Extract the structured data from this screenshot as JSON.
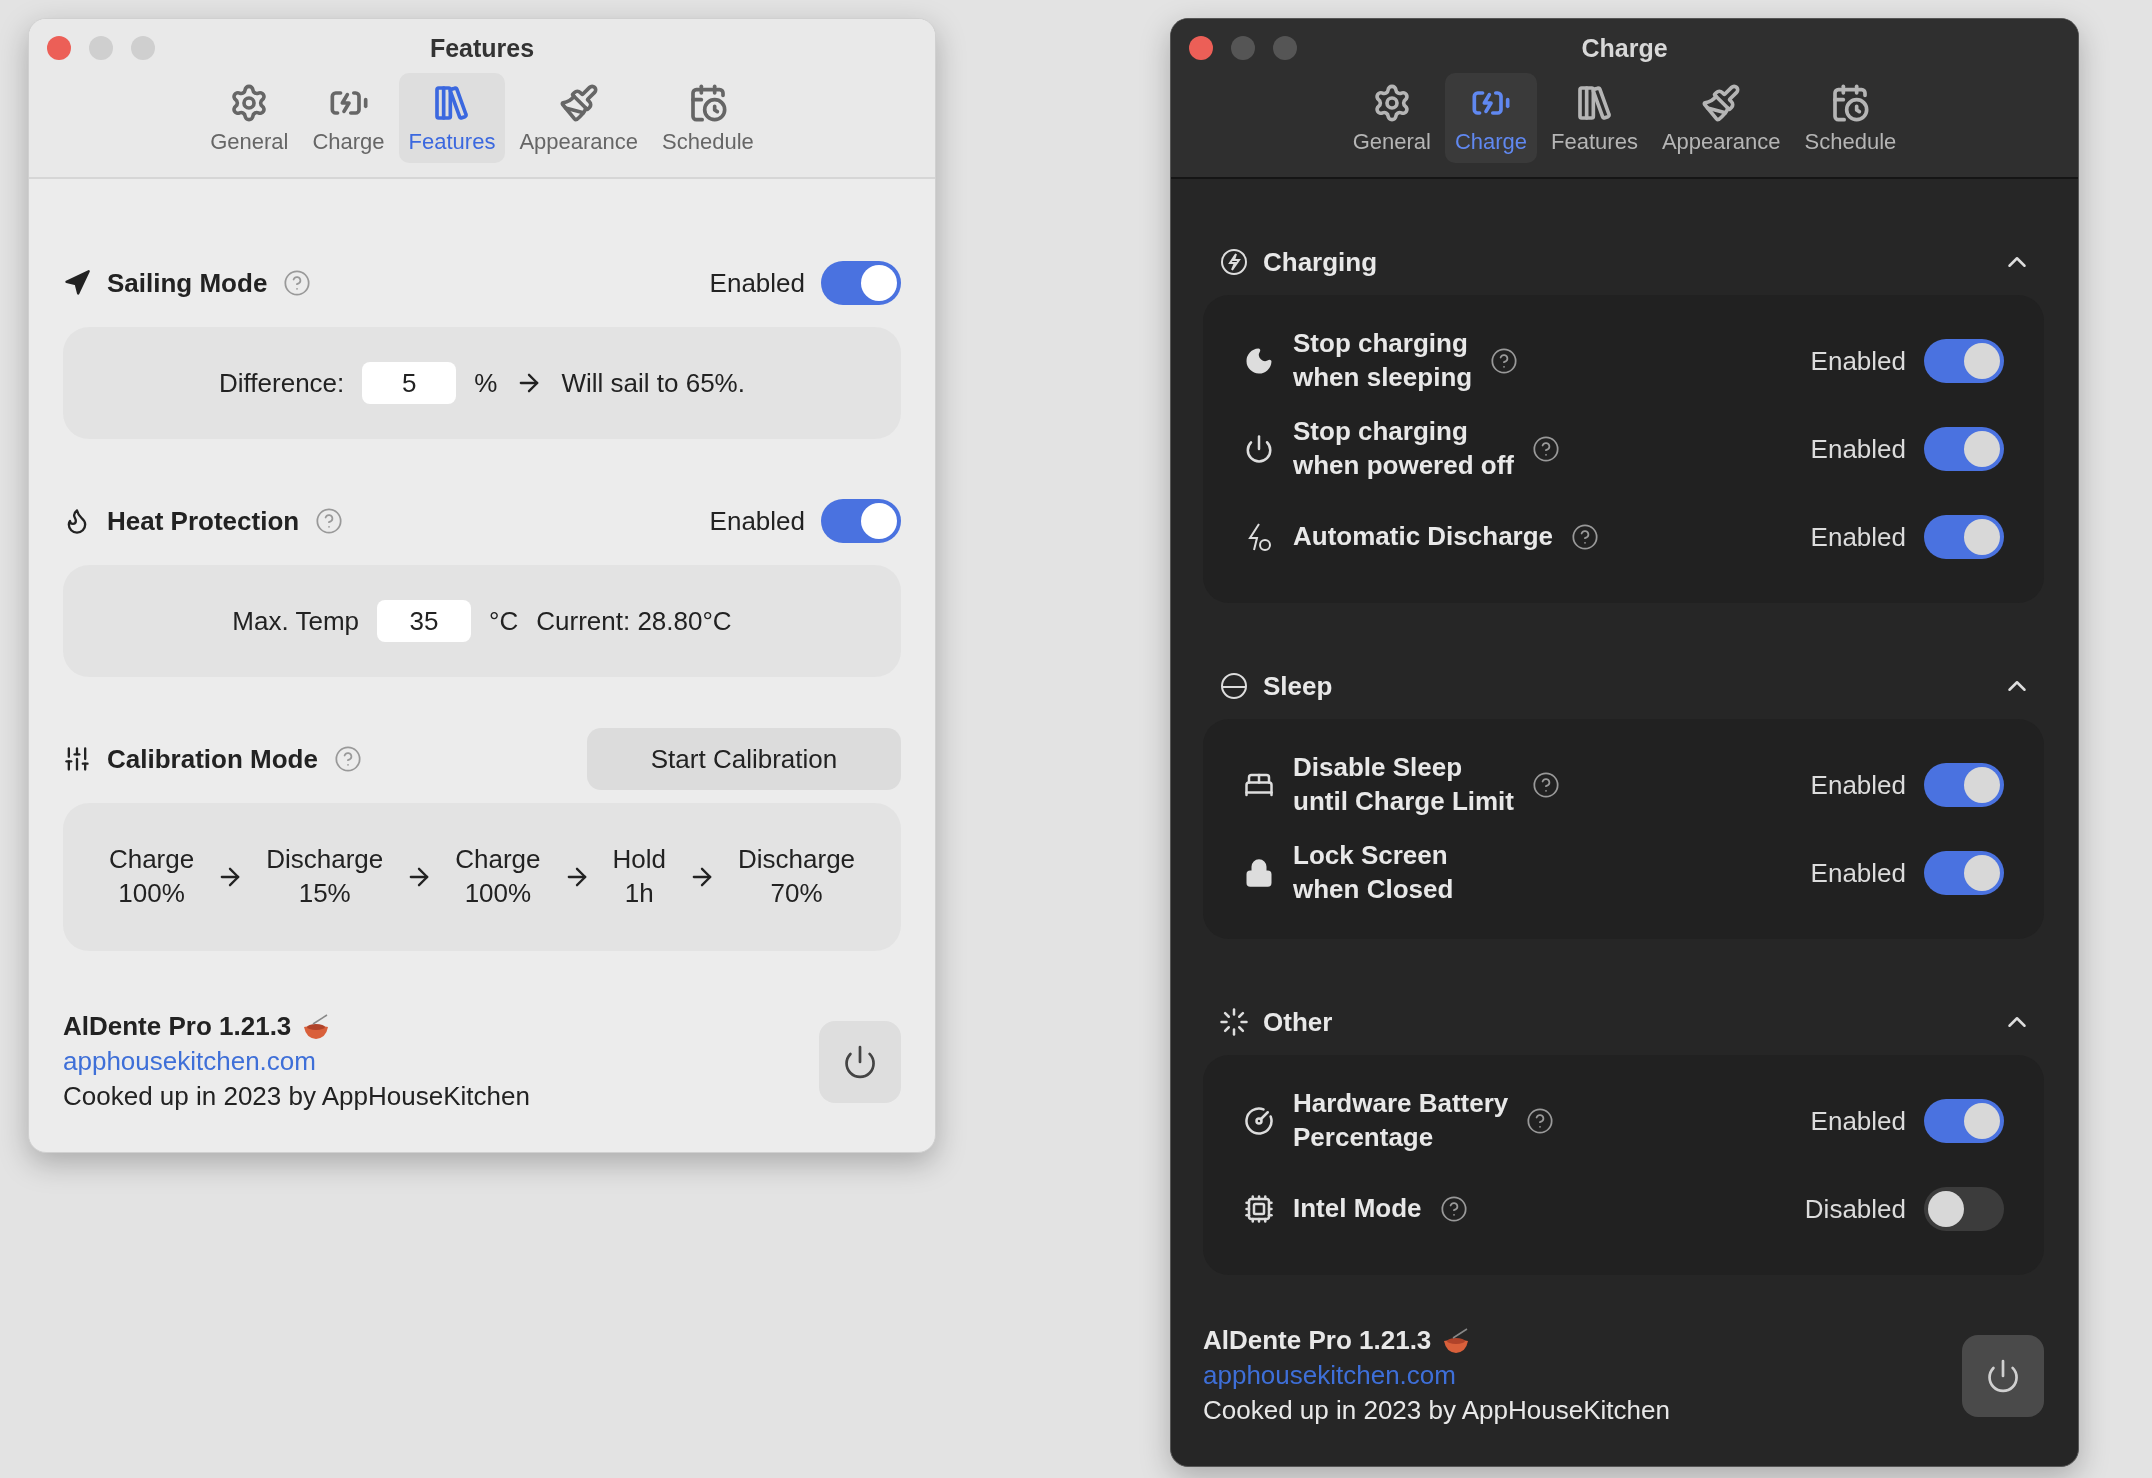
{
  "features_window": {
    "title": "Features",
    "tabs": [
      {
        "label": "General",
        "selected": false
      },
      {
        "label": "Charge",
        "selected": false
      },
      {
        "label": "Features",
        "selected": true
      },
      {
        "label": "Appearance",
        "selected": false
      },
      {
        "label": "Schedule",
        "selected": false
      }
    ],
    "sections": [
      {
        "kind": "toggle",
        "title": "Sailing Mode",
        "status": "Enabled",
        "on": true,
        "panel": {
          "kind": "field",
          "label": "Difference:",
          "value": "5",
          "unit": "%",
          "arrow": true,
          "result": "Will sail to 65%."
        }
      },
      {
        "kind": "toggle",
        "title": "Heat Protection",
        "status": "Enabled",
        "on": true,
        "panel": {
          "kind": "field",
          "label": "Max. Temp",
          "value": "35",
          "unit": "°C",
          "arrow": false,
          "result": "Current: 28.80°C"
        }
      },
      {
        "kind": "button",
        "title": "Calibration Mode",
        "button": "Start Calibration",
        "panel": {
          "kind": "steps",
          "steps": [
            {
              "name": "Charge",
              "value": "100%"
            },
            {
              "name": "Discharge",
              "value": "15%"
            },
            {
              "name": "Charge",
              "value": "100%"
            },
            {
              "name": "Hold",
              "value": "1h"
            },
            {
              "name": "Discharge",
              "value": "70%"
            }
          ]
        }
      }
    ],
    "footer": {
      "app": "AlDente Pro 1.21.3",
      "link": "apphousekitchen.com",
      "credit": "Cooked up in 2023 by AppHouseKitchen"
    }
  },
  "charge_window": {
    "title": "Charge",
    "tabs": [
      {
        "label": "General",
        "selected": false
      },
      {
        "label": "Charge",
        "selected": true
      },
      {
        "label": "Features",
        "selected": false
      },
      {
        "label": "Appearance",
        "selected": false
      },
      {
        "label": "Schedule",
        "selected": false
      }
    ],
    "groups": [
      {
        "title": "Charging",
        "expanded": true,
        "items": [
          {
            "label": "Stop charging\nwhen sleeping",
            "help": true,
            "status": "Enabled",
            "on": true
          },
          {
            "label": "Stop charging\nwhen powered off",
            "help": true,
            "status": "Enabled",
            "on": true
          },
          {
            "label": "Automatic Discharge",
            "help": true,
            "status": "Enabled",
            "on": true
          }
        ]
      },
      {
        "title": "Sleep",
        "expanded": true,
        "items": [
          {
            "label": "Disable Sleep\nuntil Charge Limit",
            "help": true,
            "status": "Enabled",
            "on": true
          },
          {
            "label": "Lock Screen\nwhen Closed",
            "help": false,
            "status": "Enabled",
            "on": true
          }
        ]
      },
      {
        "title": "Other",
        "expanded": true,
        "items": [
          {
            "label": "Hardware Battery\nPercentage",
            "help": true,
            "status": "Enabled",
            "on": true
          },
          {
            "label": "Intel Mode",
            "help": true,
            "status": "Disabled",
            "on": false
          }
        ]
      }
    ],
    "footer": {
      "app": "AlDente Pro 1.21.3",
      "link": "apphousekitchen.com",
      "credit": "Cooked up in 2023 by AppHouseKitchen"
    }
  }
}
